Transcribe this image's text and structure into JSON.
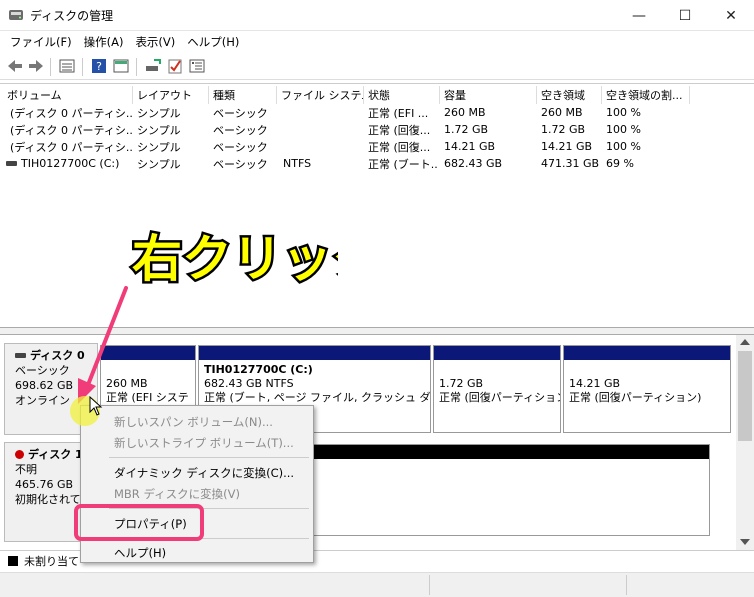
{
  "window": {
    "title": "ディスクの管理",
    "minimize": "—",
    "maximize": "☐",
    "close": "✕"
  },
  "menu": [
    "ファイル(F)",
    "操作(A)",
    "表示(V)",
    "ヘルプ(H)"
  ],
  "columns": [
    "ボリューム",
    "レイアウト",
    "種類",
    "ファイル システム",
    "状態",
    "容量",
    "空き領域",
    "空き領域の割..."
  ],
  "rows": [
    [
      "(ディスク 0 パーティシ...",
      "シンプル",
      "ベーシック",
      "",
      "正常 (EFI ...",
      "260 MB",
      "260 MB",
      "100 %"
    ],
    [
      "(ディスク 0 パーティシ...",
      "シンプル",
      "ベーシック",
      "",
      "正常 (回復...",
      "1.72 GB",
      "1.72 GB",
      "100 %"
    ],
    [
      "(ディスク 0 パーティシ...",
      "シンプル",
      "ベーシック",
      "",
      "正常 (回復...",
      "14.21 GB",
      "14.21 GB",
      "100 %"
    ],
    [
      "TIH0127700C (C:)",
      "シンプル",
      "ベーシック",
      "NTFS",
      "正常 (ブート...",
      "682.43 GB",
      "471.31 GB",
      "69 %"
    ]
  ],
  "annotation": "右クリック",
  "disk0": {
    "name": "ディスク 0",
    "type": "ベーシック",
    "size": "698.62 GB",
    "status": "オンライン",
    "partitions": [
      {
        "title": "",
        "line1": "260 MB",
        "line2": "正常 (EFI システ"
      },
      {
        "title": "TIH0127700C  (C:)",
        "line1": "682.43 GB NTFS",
        "line2": "正常 (ブート, ページ ファイル, クラッシュ ダンプ, ^"
      },
      {
        "title": "",
        "line1": "1.72 GB",
        "line2": "正常 (回復パーティション"
      },
      {
        "title": "",
        "line1": "14.21 GB",
        "line2": "正常 (回復パーティション)"
      }
    ]
  },
  "disk1": {
    "name": "ディスク 1",
    "type": "不明",
    "size": "465.76 GB",
    "status": "初期化されて"
  },
  "context_menu": {
    "items": [
      {
        "label": "新しいスパン ボリューム(N)...",
        "disabled": true
      },
      {
        "label": "新しいストライプ ボリューム(T)...",
        "disabled": true
      },
      {
        "label": "ダイナミック ディスクに変換(C)...",
        "disabled": false
      },
      {
        "label": "MBR ディスクに変換(V)",
        "disabled": true
      },
      {
        "label": "プロパティ(P)",
        "disabled": false
      },
      {
        "label": "ヘルプ(H)",
        "disabled": false
      }
    ]
  },
  "legend": {
    "unallocated": "未割り当て"
  },
  "colors": {
    "partition_bar": "#0c1878",
    "highlight": "#f03c78",
    "annotation_fill": "#ffff00"
  }
}
